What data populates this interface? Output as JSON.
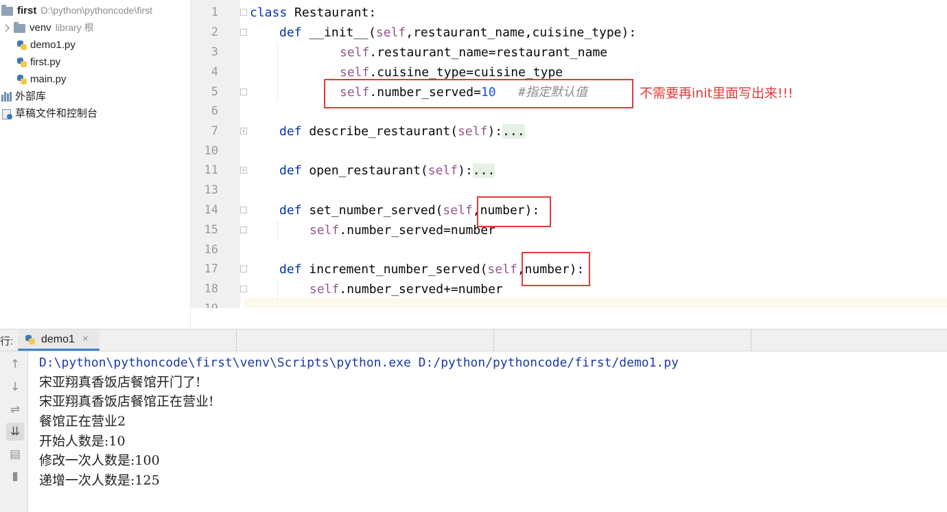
{
  "project": {
    "root_name": "first",
    "root_path": "D:\\python\\pythoncode\\first",
    "venv_name": "venv",
    "venv_hint": "library 根",
    "files": [
      "demo1.py",
      "first.py",
      "main.py"
    ],
    "external_libs": "外部库",
    "scratches": "草稿文件和控制台"
  },
  "editor": {
    "line_numbers": [
      "1",
      "2",
      "3",
      "4",
      "5",
      "6",
      "7",
      "10",
      "11",
      "13",
      "14",
      "15",
      "16",
      "17",
      "18",
      "19"
    ],
    "code": {
      "l1_kw": "class",
      "l1_rest": " Restaurant:",
      "l2_kw": "def",
      "l2_a": " __init__(",
      "l2_self": "self",
      "l2_b": ",restaurant_name,cuisine_type):",
      "l3_self": "self",
      "l3_rest": ".restaurant_name=restaurant_name",
      "l4_self": "self",
      "l4_rest": ".cuisine_type=cuisine_type",
      "l5_self": "self",
      "l5_rest": ".number_served=",
      "l5_num": "10",
      "l5_cmt": "#指定默认值",
      "l7_kw": "def",
      "l7_a": " describe_restaurant(",
      "l7_self": "self",
      "l7_b": "):",
      "l7_dots": "...",
      "l11_kw": "def",
      "l11_a": " open_restaurant(",
      "l11_self": "self",
      "l11_b": "):",
      "l11_dots": "...",
      "l14_kw": "def",
      "l14_a": " set_number_served(",
      "l14_self": "self",
      "l14_b": ",number):",
      "l15_self": "self",
      "l15_rest": ".number_served=number",
      "l17_kw": "def",
      "l17_a": " increment_number_served(",
      "l17_self": "self",
      "l17_b": ",number):",
      "l18_self": "self",
      "l18_rest": ".number_served+=number"
    },
    "annotation": "不需要再init里面写出来!!!"
  },
  "run": {
    "prefix": "行:",
    "tab_label": "demo1",
    "tab_close": "×",
    "toolbar_icons": [
      "up-arrow-icon",
      "down-arrow-icon",
      "soft-wrap-icon",
      "scroll-to-end-icon",
      "print-icon",
      "trash-icon"
    ],
    "console": [
      "D:\\python\\pythoncode\\first\\venv\\Scripts\\python.exe D:/python/pythoncode/first/demo1.py",
      "宋亚翔真香饭店餐馆开门了!",
      "宋亚翔真香饭店餐馆正在营业!",
      "餐馆正在营业2",
      "开始人数是:10",
      "修改一次人数是:100",
      "递增一次人数是:125"
    ]
  },
  "colors": {
    "keyword": "#0033b3",
    "self": "#94558d",
    "number": "#1750eb",
    "comment": "#8c8c8c",
    "annotation": "#e53935",
    "command": "#1c3ba3"
  }
}
